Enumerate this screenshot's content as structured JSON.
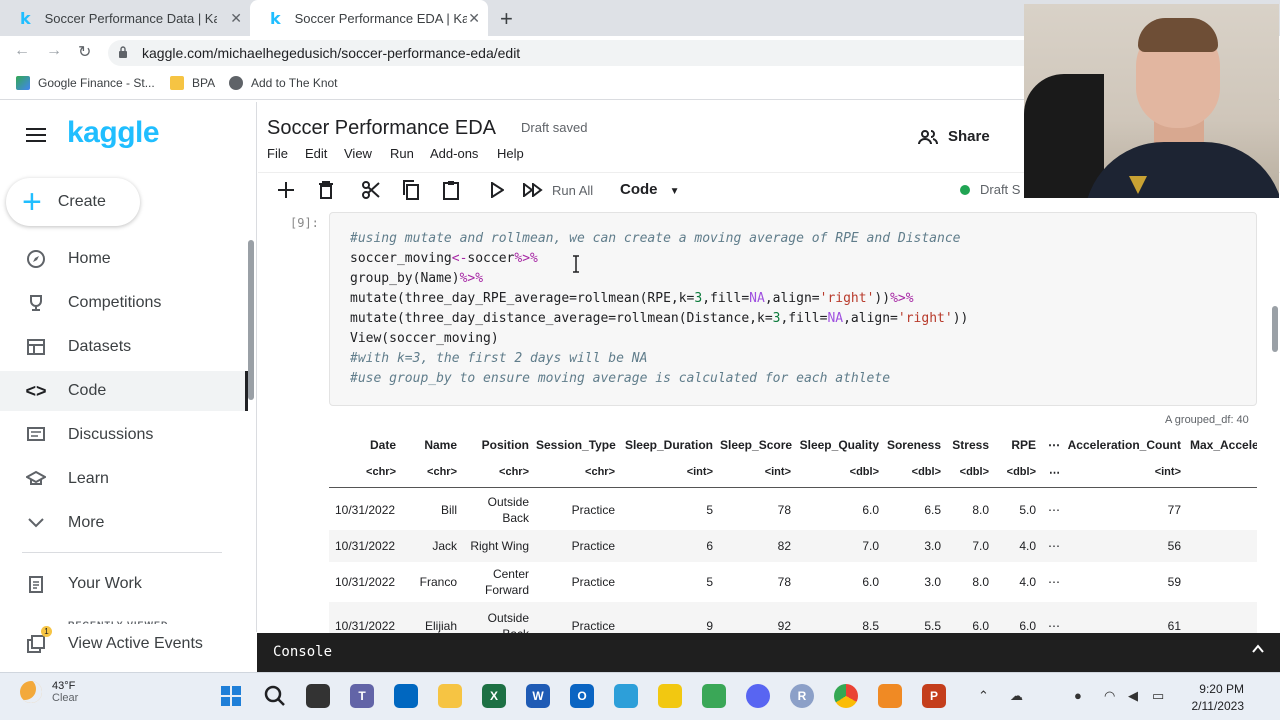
{
  "browser": {
    "tabs": [
      {
        "title": "Soccer Performance Data | Kaggle",
        "icon": "kaggle-k-icon"
      },
      {
        "title": "Soccer Performance EDA | Kaggle",
        "icon": "kaggle-k-icon"
      }
    ],
    "url": "kaggle.com/michaelhegedusich/soccer-performance-eda/edit",
    "bookmarks": [
      "Google Finance - St...",
      "BPA",
      "Add to The Knot"
    ]
  },
  "sidebar": {
    "logo": "kaggle",
    "create_label": "Create",
    "items": [
      {
        "label": "Home",
        "icon": "compass-icon"
      },
      {
        "label": "Competitions",
        "icon": "trophy-icon"
      },
      {
        "label": "Datasets",
        "icon": "table-icon"
      },
      {
        "label": "Code",
        "icon": "code-icon"
      },
      {
        "label": "Discussions",
        "icon": "comment-icon"
      },
      {
        "label": "Learn",
        "icon": "graduation-cap-icon"
      },
      {
        "label": "More",
        "icon": "chevron-down-icon"
      },
      {
        "label": "Your Work",
        "icon": "clipboard-icon"
      },
      {
        "label": "View Active Events",
        "icon": "events-icon"
      }
    ],
    "active_item": "Code",
    "recent_label": "RECENTLY VIEWED",
    "events_badge": "1"
  },
  "notebook": {
    "title": "Soccer Performance EDA",
    "save_status": "Draft saved",
    "menu": [
      "File",
      "Edit",
      "View",
      "Run",
      "Add-ons",
      "Help"
    ],
    "share_label": "Share",
    "run_all_label": "Run All",
    "cell_type": "Code",
    "session_status": "Draft S",
    "cell_prompt": "[9]:",
    "code_lines": [
      "#using mutate and rollmean, we can create a moving average of RPE and Distance",
      "soccer_moving<-soccer%>%",
      "group_by(Name)%>%",
      "mutate(three_day_RPE_average=rollmean(RPE,k=3,fill=NA,align='right'))%>%",
      "mutate(three_day_distance_average=rollmean(Distance,k=3,fill=NA,align='right'))",
      "View(soccer_moving)",
      "#with k=3, the first 2 days will be NA",
      "#use group_by to ensure moving average is calculated for each athlete"
    ]
  },
  "output": {
    "caption": "A grouped_df: 40",
    "columns": [
      "Date",
      "Name",
      "Position",
      "Session_Type",
      "Sleep_Duration",
      "Sleep_Score",
      "Sleep_Quality",
      "Soreness",
      "Stress",
      "RPE",
      "⋯",
      "Acceleration_Count",
      "Max_Accele"
    ],
    "types": [
      "<chr>",
      "<chr>",
      "<chr>",
      "<chr>",
      "<int>",
      "<int>",
      "<dbl>",
      "<dbl>",
      "<dbl>",
      "<dbl>",
      "⋯",
      "<int>",
      ""
    ],
    "rows": [
      [
        "10/31/2022",
        "Bill",
        "Outside Back",
        "Practice",
        "5",
        "78",
        "6.0",
        "6.5",
        "8.0",
        "5.0",
        "⋯",
        "77"
      ],
      [
        "10/31/2022",
        "Jack",
        "Right Wing",
        "Practice",
        "6",
        "82",
        "7.0",
        "3.0",
        "7.0",
        "4.0",
        "⋯",
        "56"
      ],
      [
        "10/31/2022",
        "Franco",
        "Center Forward",
        "Practice",
        "5",
        "78",
        "6.0",
        "3.0",
        "8.0",
        "4.0",
        "⋯",
        "59"
      ],
      [
        "10/31/2022",
        "Elijiah",
        "Outside Back",
        "Practice",
        "9",
        "92",
        "8.5",
        "5.5",
        "6.0",
        "6.0",
        "⋯",
        "61"
      ]
    ]
  },
  "console": {
    "label": "Console"
  },
  "taskbar": {
    "weather_temp": "43°F",
    "weather_desc": "Clear",
    "time": "9:20 PM",
    "date": "2/11/2023",
    "apps": [
      "windows-start-icon",
      "search-icon",
      "task-view-icon",
      "teams-icon",
      "store-icon",
      "file-explorer-icon",
      "excel-icon",
      "word-icon",
      "outlook-icon",
      "snip-icon",
      "power-bi-icon",
      "edge-icon",
      "discord-icon",
      "r-icon",
      "chrome-icon",
      "media-icon",
      "powerpoint-icon"
    ]
  },
  "colors": {
    "kaggle_blue": "#20beff",
    "console_bg": "#1f1f1f",
    "status_green": "#20a453"
  }
}
